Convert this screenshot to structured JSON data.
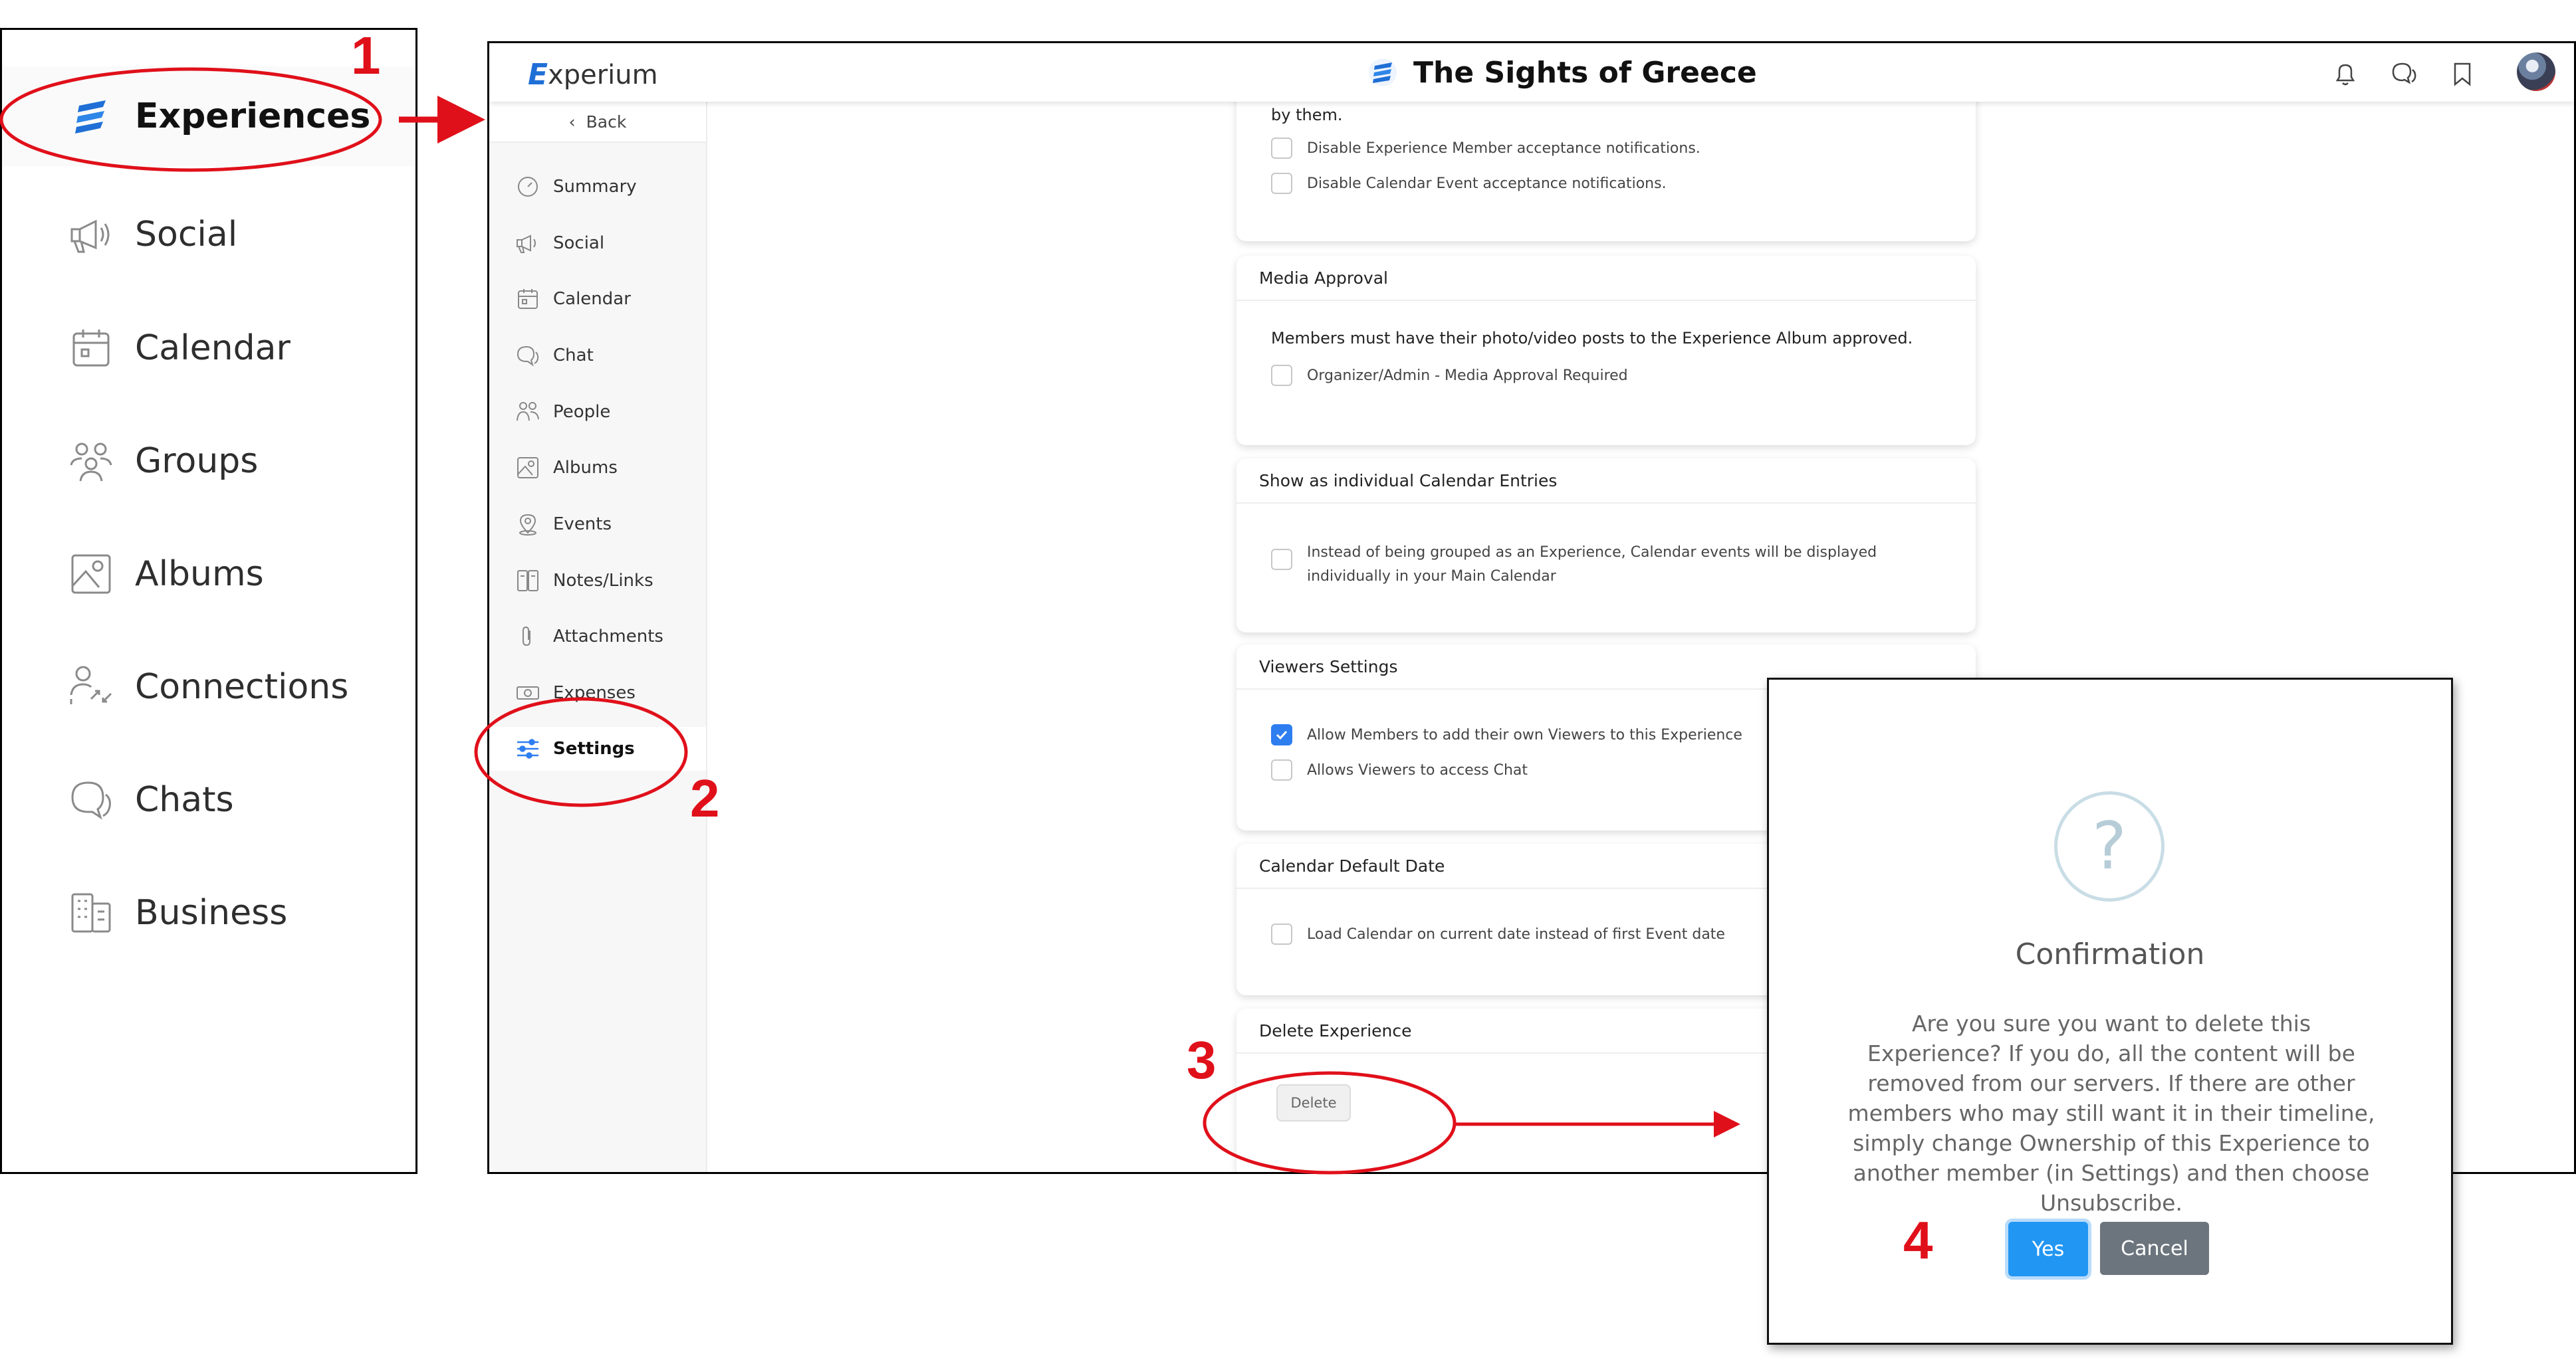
{
  "left_panel": {
    "items": [
      {
        "label": "Experiences",
        "icon": "experium-logo-icon"
      },
      {
        "label": "Social",
        "icon": "megaphone-icon"
      },
      {
        "label": "Calendar",
        "icon": "calendar-icon"
      },
      {
        "label": "Groups",
        "icon": "groups-icon"
      },
      {
        "label": "Albums",
        "icon": "album-icon"
      },
      {
        "label": "Connections",
        "icon": "connections-icon"
      },
      {
        "label": "Chats",
        "icon": "chat-icon"
      },
      {
        "label": "Business",
        "icon": "business-icon"
      }
    ]
  },
  "app": {
    "logo_e": "E",
    "logo_rest": "xperium",
    "title": "The Sights of Greece",
    "back_label": "Back",
    "nav": [
      {
        "label": "Summary",
        "icon": "gauge-icon"
      },
      {
        "label": "Social",
        "icon": "megaphone-icon"
      },
      {
        "label": "Calendar",
        "icon": "calendar-icon"
      },
      {
        "label": "Chat",
        "icon": "chat-icon"
      },
      {
        "label": "People",
        "icon": "people-icon"
      },
      {
        "label": "Albums",
        "icon": "album-icon"
      },
      {
        "label": "Events",
        "icon": "location-pin-icon"
      },
      {
        "label": "Notes/Links",
        "icon": "notes-icon"
      },
      {
        "label": "Attachments",
        "icon": "paperclip-icon"
      },
      {
        "label": "Expenses",
        "icon": "money-icon"
      },
      {
        "label": "Settings",
        "icon": "sliders-icon"
      }
    ],
    "cards": {
      "notifications": {
        "partial_text": "by them.",
        "options": [
          "Disable Experience Member acceptance notifications.",
          "Disable Calendar Event acceptance notifications."
        ]
      },
      "media": {
        "title": "Media Approval",
        "description": "Members must have their photo/video posts to the Experience Album approved.",
        "option": "Organizer/Admin - Media Approval Required"
      },
      "individual": {
        "title": "Show as individual Calendar Entries",
        "option_line1": "Instead of being grouped as an Experience, Calendar events will be displayed",
        "option_line2": "individually in your Main Calendar"
      },
      "viewers": {
        "title": "Viewers Settings",
        "option1": "Allow Members to add their own Viewers to this Experience",
        "option2": "Allows Viewers to access Chat",
        "option1_checked": true
      },
      "default_date": {
        "title": "Calendar Default Date",
        "option": "Load Calendar on current date instead of first Event date"
      },
      "delete": {
        "title": "Delete Experience",
        "button": "Delete"
      }
    }
  },
  "modal": {
    "icon_glyph": "?",
    "title": "Confirmation",
    "message": "Are you sure you want to delete this Experience? If you do, all the content will be removed from our servers. If there are other members who may still want it in their timeline, simply change Ownership of this Experience to another member (in Settings) and then choose Unsubscribe.",
    "yes": "Yes",
    "cancel": "Cancel"
  },
  "annotations": {
    "step1": "1",
    "step2": "2",
    "step3": "3",
    "step4": "4",
    "color": "#e0101a"
  }
}
